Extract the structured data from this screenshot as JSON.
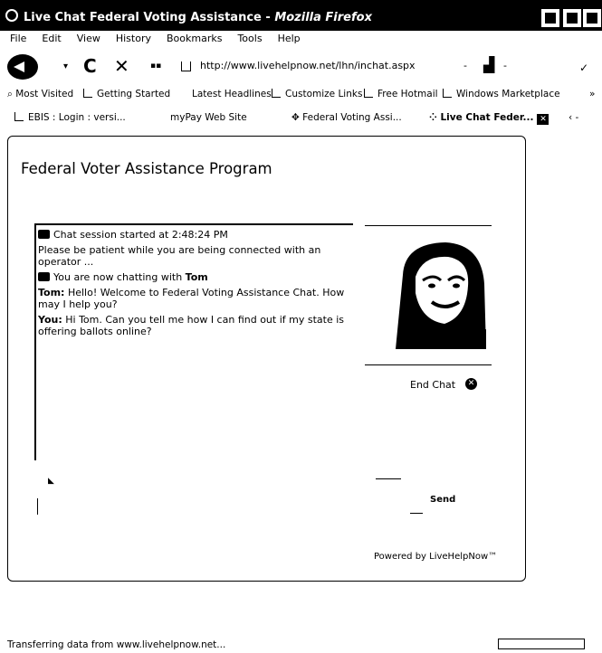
{
  "window": {
    "title_prefix": "Live Chat Federal Voting Assistance - ",
    "title_app": "Mozilla Firefox"
  },
  "menu": [
    "File",
    "Edit",
    "View",
    "History",
    "Bookmarks",
    "Tools",
    "Help"
  ],
  "nav": {
    "url": "http://www.livehelpnow.net/lhn/inchat.aspx"
  },
  "bookmarks": [
    "Most Visited",
    "Getting Started",
    "Latest Headlines",
    "Customize Links",
    "Free Hotmail",
    "Windows Marketplace"
  ],
  "bookmarks_more": "»",
  "tabs": [
    {
      "label": "EBIS : Login : versi..."
    },
    {
      "label": "myPay Web Site"
    },
    {
      "label": "Federal Voting Assi..."
    },
    {
      "label": "Live Chat Feder..."
    }
  ],
  "chat": {
    "heading": "Federal Voter Assistance Program",
    "messages": [
      {
        "kind": "system",
        "text": "Chat session started at 2:48:24 PM"
      },
      {
        "kind": "plain",
        "text": "Please be patient while you are being connected with an operator ..."
      },
      {
        "kind": "system",
        "prefix": "You are now chatting with ",
        "who": "Tom"
      },
      {
        "kind": "message",
        "who": "Tom:",
        "text": " Hello! Welcome to Federal Voting Assistance Chat. How may I help you?"
      },
      {
        "kind": "message",
        "who": "You:",
        "text": " Hi Tom. Can you tell me how I can find out if my state is offering ballots online?"
      }
    ],
    "end_chat": "End Chat",
    "send": "Send",
    "powered_by": "Powered by LiveHelpNow™"
  },
  "status": {
    "text": "Transferring data from www.livehelpnow.net...",
    "progress": 0
  },
  "icons": {
    "back": "back-arrow-icon",
    "reload": "reload-icon",
    "stop": "stop-icon",
    "end_chat": "close-circle-icon",
    "message": "chat-bubble-icon"
  }
}
